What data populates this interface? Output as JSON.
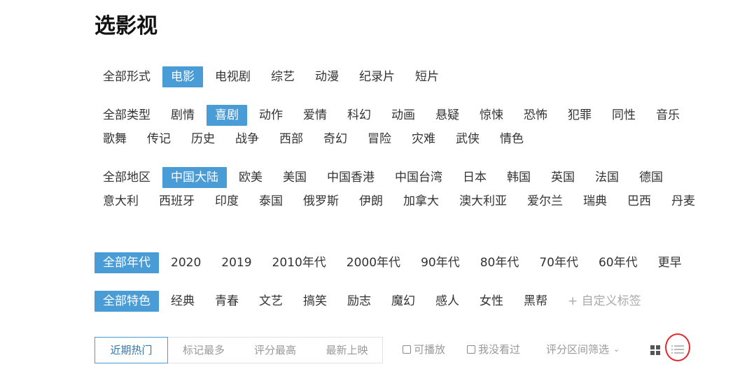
{
  "page": {
    "title": "选影视"
  },
  "filters": {
    "forms": [
      "全部形式",
      "电影",
      "电视剧",
      "综艺",
      "动漫",
      "纪录片",
      "短片"
    ],
    "forms_active": 1,
    "genres": [
      "全部类型",
      "剧情",
      "喜剧",
      "动作",
      "爱情",
      "科幻",
      "动画",
      "悬疑",
      "惊悚",
      "恐怖",
      "犯罪",
      "同性",
      "音乐",
      "歌舞",
      "传记",
      "历史",
      "战争",
      "西部",
      "奇幻",
      "冒险",
      "灾难",
      "武侠",
      "情色"
    ],
    "genres_active": 2,
    "regions": [
      "全部地区",
      "中国大陆",
      "欧美",
      "美国",
      "中国香港",
      "中国台湾",
      "日本",
      "韩国",
      "英国",
      "法国",
      "德国",
      "意大利",
      "西班牙",
      "印度",
      "泰国",
      "俄罗斯",
      "伊朗",
      "加拿大",
      "澳大利亚",
      "爱尔兰",
      "瑞典",
      "巴西",
      "丹麦"
    ],
    "regions_active": 1,
    "years": [
      "全部年代",
      "2020",
      "2019",
      "2010年代",
      "2000年代",
      "90年代",
      "80年代",
      "70年代",
      "60年代",
      "更早"
    ],
    "years_active": 0,
    "features": [
      "全部特色",
      "经典",
      "青春",
      "文艺",
      "搞笑",
      "励志",
      "魔幻",
      "感人",
      "女性",
      "黑帮"
    ],
    "features_active": 0,
    "custom_tag_label": "+ 自定义标签"
  },
  "toolbar": {
    "sort_options": [
      "近期热门",
      "标记最多",
      "评分最高",
      "最新上映"
    ],
    "sort_active": 0,
    "playable_label": "可播放",
    "not_seen_label": "我没看过",
    "rating_range_label": "评分区间筛选",
    "view_icons": [
      "grid-view-icon",
      "list-view-icon"
    ]
  },
  "colors": {
    "accent": "#4a9cd6",
    "highlight_annotation": "#e0282f"
  }
}
